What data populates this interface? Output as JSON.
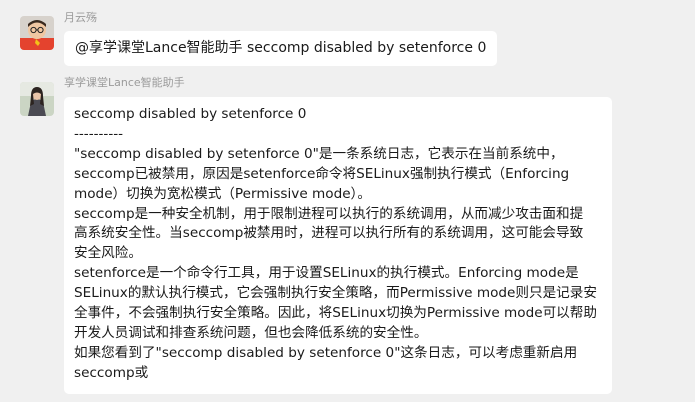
{
  "messages": [
    {
      "sender": "月云殇",
      "text": "@享学课堂Lance智能助手 seccomp disabled by setenforce 0"
    },
    {
      "sender": "享学课堂Lance智能助手",
      "lines": [
        "seccomp disabled by setenforce 0",
        "----------",
        "\"seccomp disabled by setenforce 0\"是一条系统日志，它表示在当前系统中，",
        "seccomp已被禁用，原因是setenforce命令将SELinux强制执行模式（Enforcing",
        "mode）切换为宽松模式（Permissive mode）。",
        "seccomp是一种安全机制，用于限制进程可以执行的系统调用，从而减少攻击面和提",
        "高系统安全性。当seccomp被禁用时，进程可以执行所有的系统调用，这可能会导致",
        "安全风险。",
        "setenforce是一个命令行工具，用于设置SELinux的执行模式。Enforcing mode是",
        "SELinux的默认执行模式，它会强制执行安全策略，而Permissive mode则只是记录安",
        "全事件，不会强制执行安全策略。因此，将SELinux切换为Permissive mode可以帮助",
        "开发人员调试和排查系统问题，但也会降低系统的安全性。",
        "如果您看到了\"seccomp disabled by setenforce 0\"这条日志，可以考虑重新启用",
        "seccomp或"
      ]
    }
  ],
  "colors": {
    "background": "#f0f0f0",
    "bubble": "#ffffff",
    "sender_name": "#9b9b9b",
    "text": "#1a1a1a"
  }
}
